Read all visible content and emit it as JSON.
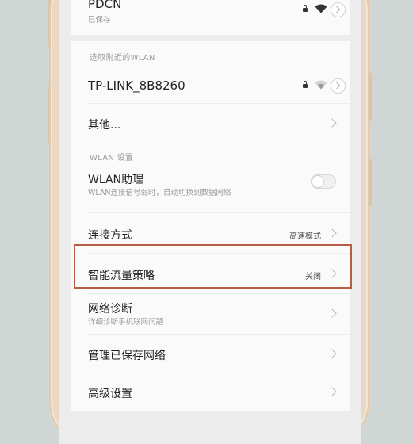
{
  "saved_network": {
    "name": "PDCN",
    "status": "已保存"
  },
  "nearby": {
    "section_title": "选取附近的WLAN",
    "network_name": "TP-LINK_8B8260",
    "other": "其他..."
  },
  "settings": {
    "section_title": "WLAN 设置",
    "assistant": {
      "label": "WLAN助理",
      "description": "WLAN连接信号弱时，自动切换到数据网络",
      "enabled": false
    },
    "connection_mode": {
      "label": "连接方式",
      "value": "高速模式"
    },
    "smart_traffic": {
      "label": "智能流量策略",
      "value": "关闭"
    },
    "diagnostics": {
      "label": "网络诊断",
      "description": "详细诊断手机联网问题"
    },
    "manage_saved": {
      "label": "管理已保存网络"
    },
    "advanced": {
      "label": "高级设置"
    }
  },
  "colors": {
    "highlight": "#b85c44",
    "frame": "#ead8c4"
  },
  "icons": [
    "lock-icon",
    "wifi-icon",
    "info-icon",
    "chevron-right-icon"
  ]
}
